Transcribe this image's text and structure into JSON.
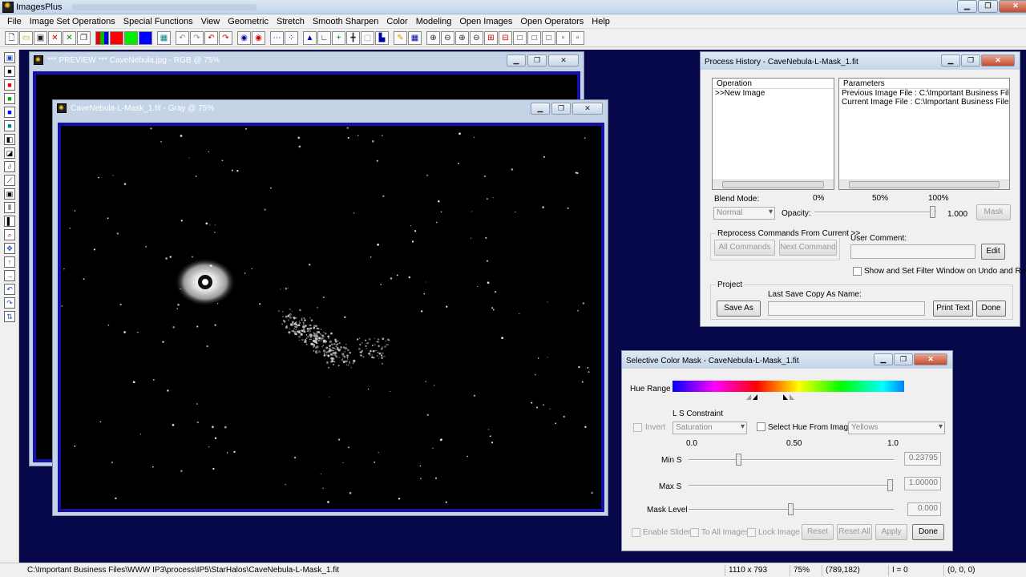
{
  "app": {
    "title": "ImagesPlus",
    "title_buttons": [
      "▁",
      "❐",
      "✕"
    ]
  },
  "menu": [
    "File",
    "Image Set Operations",
    "Special Functions",
    "View",
    "Geometric",
    "Stretch",
    "Smooth Sharpen",
    "Color",
    "Modeling",
    "Open Images",
    "Open Operators",
    "Help"
  ],
  "preview_window": {
    "title": "*** PREVIEW *** CaveNebula.jpg - RGB @ 75%",
    "buttons": [
      "▁",
      "❐",
      "✕"
    ]
  },
  "mask_window": {
    "title": "CaveNebula-L-Mask_1.fit - Gray @ 75%",
    "buttons": [
      "▁",
      "❐",
      "✕"
    ]
  },
  "process_history": {
    "title": "Process History - CaveNebula-L-Mask_1.fit",
    "operation_header": "Operation",
    "operations": [
      ">>New Image"
    ],
    "parameters_header": "Parameters",
    "parameters": [
      "Previous Image File : C:\\Important Business Files\\WW...",
      "Current Image File : C:\\Important Business Files\\WW..."
    ],
    "blend_mode_label": "Blend Mode:",
    "blend_mode_value": "Normal",
    "opacity_label": "Opacity:",
    "opacity_ticks": [
      "0%",
      "50%",
      "100%"
    ],
    "opacity_value": "1.000",
    "opacity_level": 1.0,
    "mask_button": "Mask",
    "reprocess_label": "Reprocess Commands From Current >>",
    "all_commands_button": "All Commands",
    "next_command_button": "Next Command",
    "user_comment_label": "User Comment:",
    "edit_button": "Edit",
    "show_filter_label": "Show and Set Filter Window on Undo and Redo",
    "project_label": "Project",
    "save_as_button": "Save As",
    "last_save_label": "Last Save Copy As Name:",
    "print_text_button": "Print Text",
    "done_button": "Done"
  },
  "selective_color_mask": {
    "title": "Selective Color Mask - CaveNebula-L-Mask_1.fit",
    "hue_range_label": "Hue Range",
    "invert_label": "Invert",
    "ls_constraint_label": "L S Constraint",
    "ls_constraint_value": "Saturation",
    "select_hue_label": "Select Hue From Image",
    "hue_preset_value": "Yellows",
    "scale_ticks": [
      "0.0",
      "0.50",
      "1.0"
    ],
    "sliders": [
      {
        "label": "Min S",
        "value": "0.23795",
        "level": 0.23795
      },
      {
        "label": "Max S",
        "value": "1.00000",
        "level": 1.0
      },
      {
        "label": "Mask Level",
        "value": "0.000",
        "level": 0.5
      }
    ],
    "enable_sliders_label": "Enable Sliders",
    "to_all_images_label": "To All Images",
    "lock_image_label": "Lock Image",
    "reset_button": "Reset",
    "reset_all_button": "Reset All",
    "apply_button": "Apply",
    "done_button": "Done"
  },
  "status": {
    "path": "C:\\Important Business Files\\WWW IP3\\process\\IP5\\StarHalos\\CaveNebula-L-Mask_1.fit",
    "dimensions": "1110 x 793",
    "zoom": "75%",
    "cursor": "(789,182)",
    "intensity": "I = 0",
    "color": "(0, 0, 0)"
  }
}
